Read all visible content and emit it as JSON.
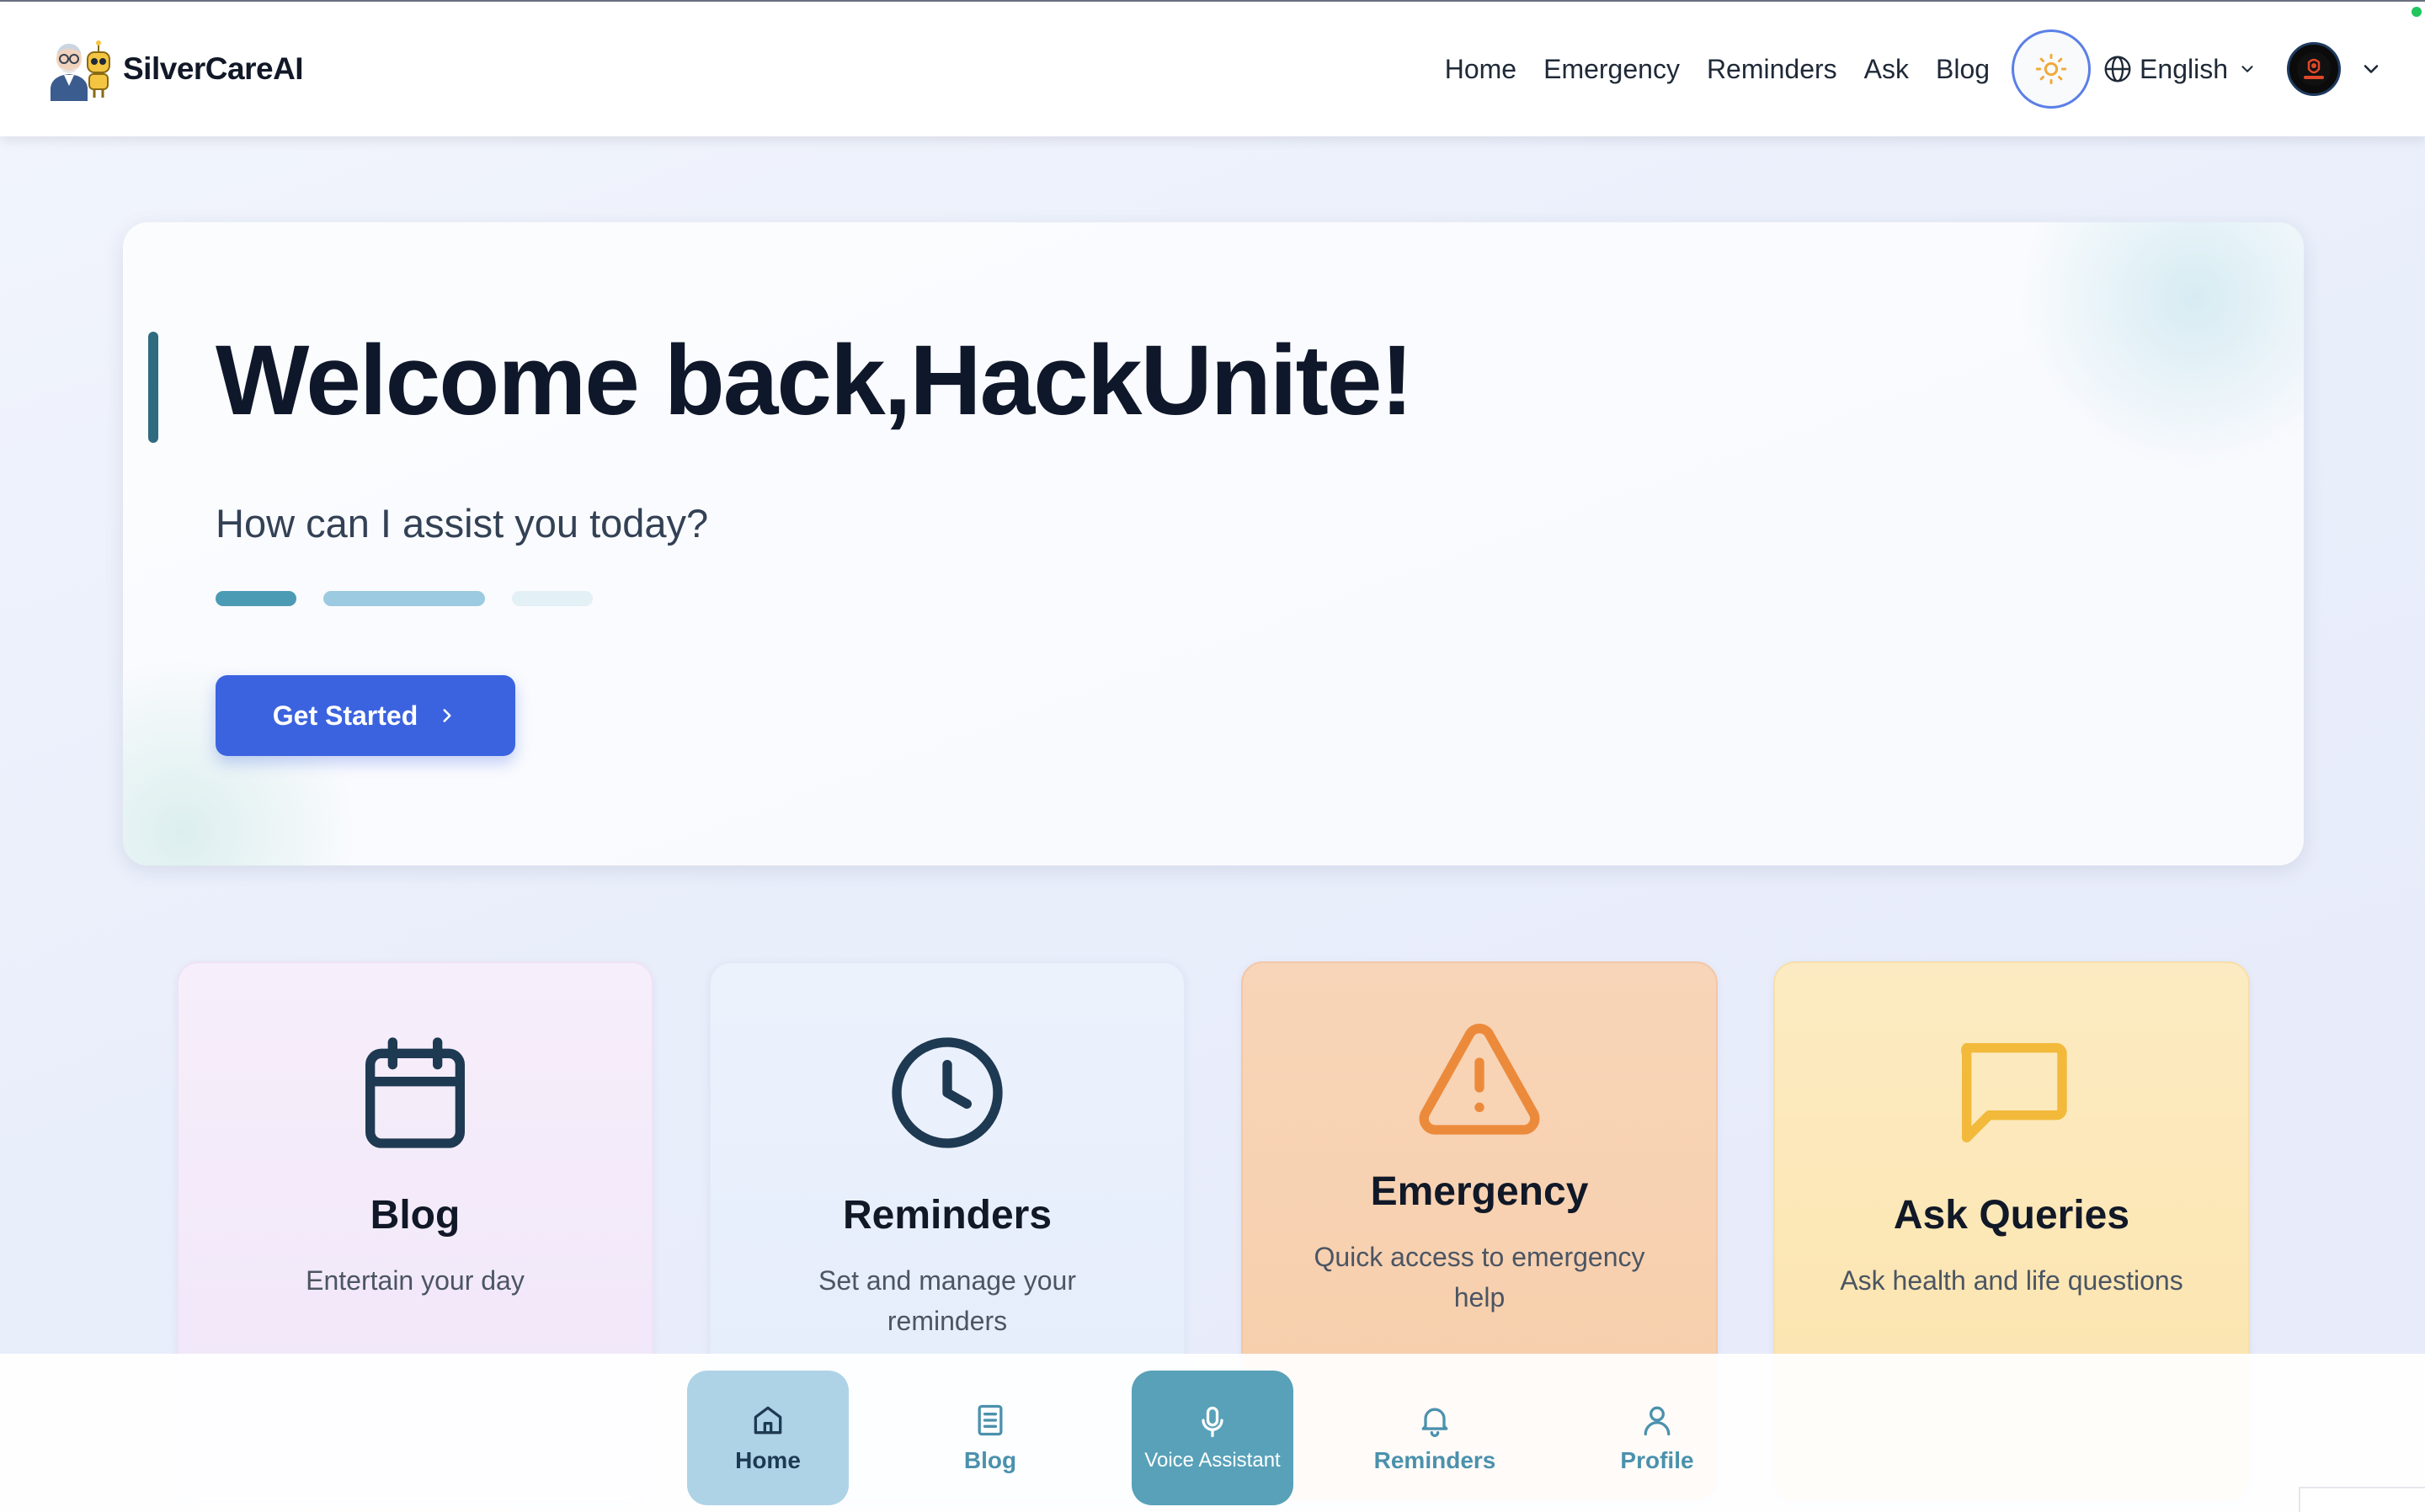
{
  "header": {
    "brand": "SilverCareAI",
    "nav": [
      "Home",
      "Emergency",
      "Reminders",
      "Ask",
      "Blog"
    ],
    "language": "English"
  },
  "hero": {
    "title": "Welcome back,HackUnite!",
    "subtitle": "How can I assist you today?",
    "cta": "Get Started"
  },
  "cards": [
    {
      "title": "Blog",
      "desc": "Entertain your day",
      "icon": "calendar-icon",
      "color": "#1e3a52"
    },
    {
      "title": "Reminders",
      "desc": "Set and manage your reminders",
      "icon": "clock-icon",
      "color": "#1e3a52"
    },
    {
      "title": "Emergency",
      "desc": "Quick access to emergency help",
      "icon": "warning-triangle-icon",
      "color": "#ec8a3c"
    },
    {
      "title": "Ask Queries",
      "desc": "Ask health and life questions",
      "icon": "chat-bubble-icon",
      "color": "#f2b93b"
    }
  ],
  "bottom_nav": [
    {
      "label": "Home",
      "icon": "home-icon",
      "active": true
    },
    {
      "label": "Blog",
      "icon": "book-icon"
    },
    {
      "label": "Voice Assistant",
      "icon": "microphone-icon"
    },
    {
      "label": "Reminders",
      "icon": "bell-icon"
    },
    {
      "label": "Profile",
      "icon": "user-icon"
    }
  ],
  "colors": {
    "primary": "#3b63e0",
    "accent": "#58a1b9",
    "emergency": "#ec8a3c",
    "ask": "#f2b93b"
  }
}
